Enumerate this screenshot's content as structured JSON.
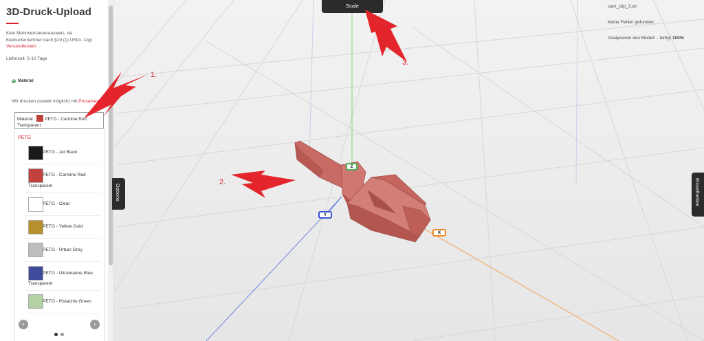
{
  "panel": {
    "title": "3D-Druck-Upload",
    "tax_text": "Kein Mehrwertsteuerausweis, da Kleinunternehmer nach §19 (1) UStG. zzgl.",
    "tax_link": "Versandkosten",
    "delivery": "Lieferzeit: 5-10 Tage",
    "material_heading": "Material",
    "print_note": "Wir drucken (soweit möglich) mit",
    "print_note_link": "Prusament",
    "select_prefix": "Material :",
    "select_value": "PETG - Carmine Red",
    "select_value_line2": "Transparent",
    "group_label": "PETG",
    "options": [
      {
        "label": "PETG - Jet Black",
        "color": "#1a1a1a"
      },
      {
        "label": "PETG - Carmine Red",
        "label2": "Transparent",
        "color": "#c0413e"
      },
      {
        "label": "PETG - Clear",
        "color": "#ffffff"
      },
      {
        "label": "PETG - Yellow Gold",
        "color": "#b5902b"
      },
      {
        "label": "PETG - Urban Grey",
        "color": "#bdbdbd"
      },
      {
        "label": "PETG - Ultramarine Blue",
        "label2": "Transparent",
        "color": "#3e4a9a"
      },
      {
        "label": "PETG - Pistachio Green",
        "color": "#b3d1a4"
      }
    ],
    "prev_icon": "‹",
    "next_icon": "›"
  },
  "tabs": {
    "options": "Options",
    "details": "Einzelheiten",
    "scale": "Scale"
  },
  "info": {
    "filename": "cam_clip_3.stl",
    "errors": "Keine Fehler gefunden.",
    "analysis": "Analysieren des Modell .. fertig!",
    "analysis_pct": "100%"
  },
  "annotations": {
    "one": "1.",
    "two": "2.",
    "three": "3."
  },
  "axes": {
    "x": "X",
    "y": "Y",
    "z": "Z"
  },
  "colors": {
    "accent": "#d9232d",
    "model": "#c9706a",
    "axis_x": "#f08a24",
    "axis_y": "#3a4fd6",
    "axis_z": "#47b34d"
  }
}
